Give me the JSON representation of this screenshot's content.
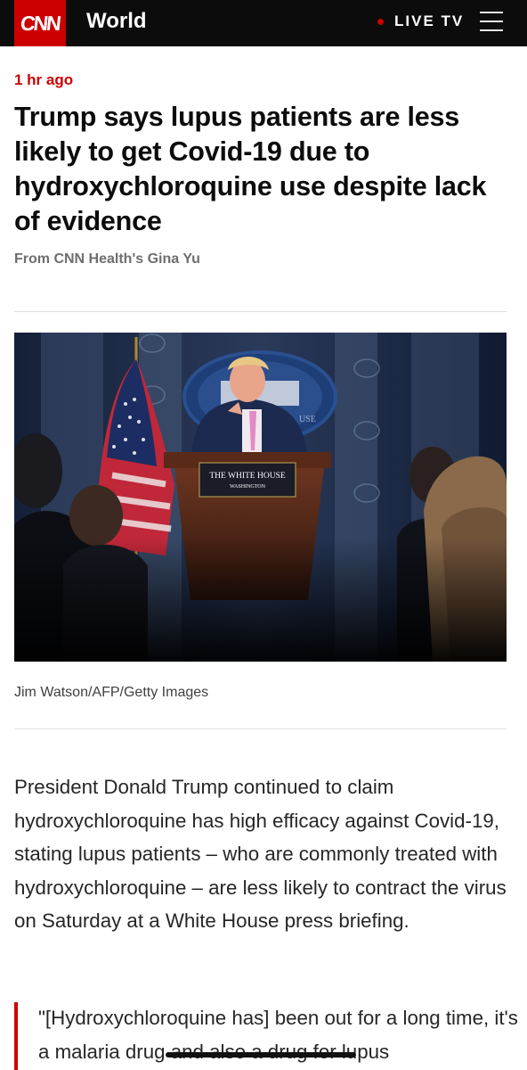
{
  "header": {
    "logo_text": "CNN",
    "section": "World",
    "live_label": "LIVE TV",
    "brand_color": "#cc0000",
    "menu_icon": "hamburger-menu-icon"
  },
  "article": {
    "timestamp": "1 hr ago",
    "headline": "Trump says lupus patients are less likely to get Covid-19 due to hydroxychloroquine use despite lack of evidence",
    "byline": "From CNN Health's Gina Yu",
    "image": {
      "podium_sign": "THE WHITE HOUSE",
      "podium_sign_sub": "WASHINGTON",
      "seal_text": "USE"
    },
    "photo_credit": "Jim Watson/AFP/Getty Images",
    "paragraph": "President Donald Trump continued to claim hydroxychloroquine has high efficacy against Covid-19, stating lupus patients – who are commonly treated with hydroxychloroquine – are less likely to contract the virus on Saturday at a White House press briefing.",
    "quote": "\"[Hydroxychloroquine has] been out for a long time, it's a malaria drug and also a drug for lupus"
  }
}
